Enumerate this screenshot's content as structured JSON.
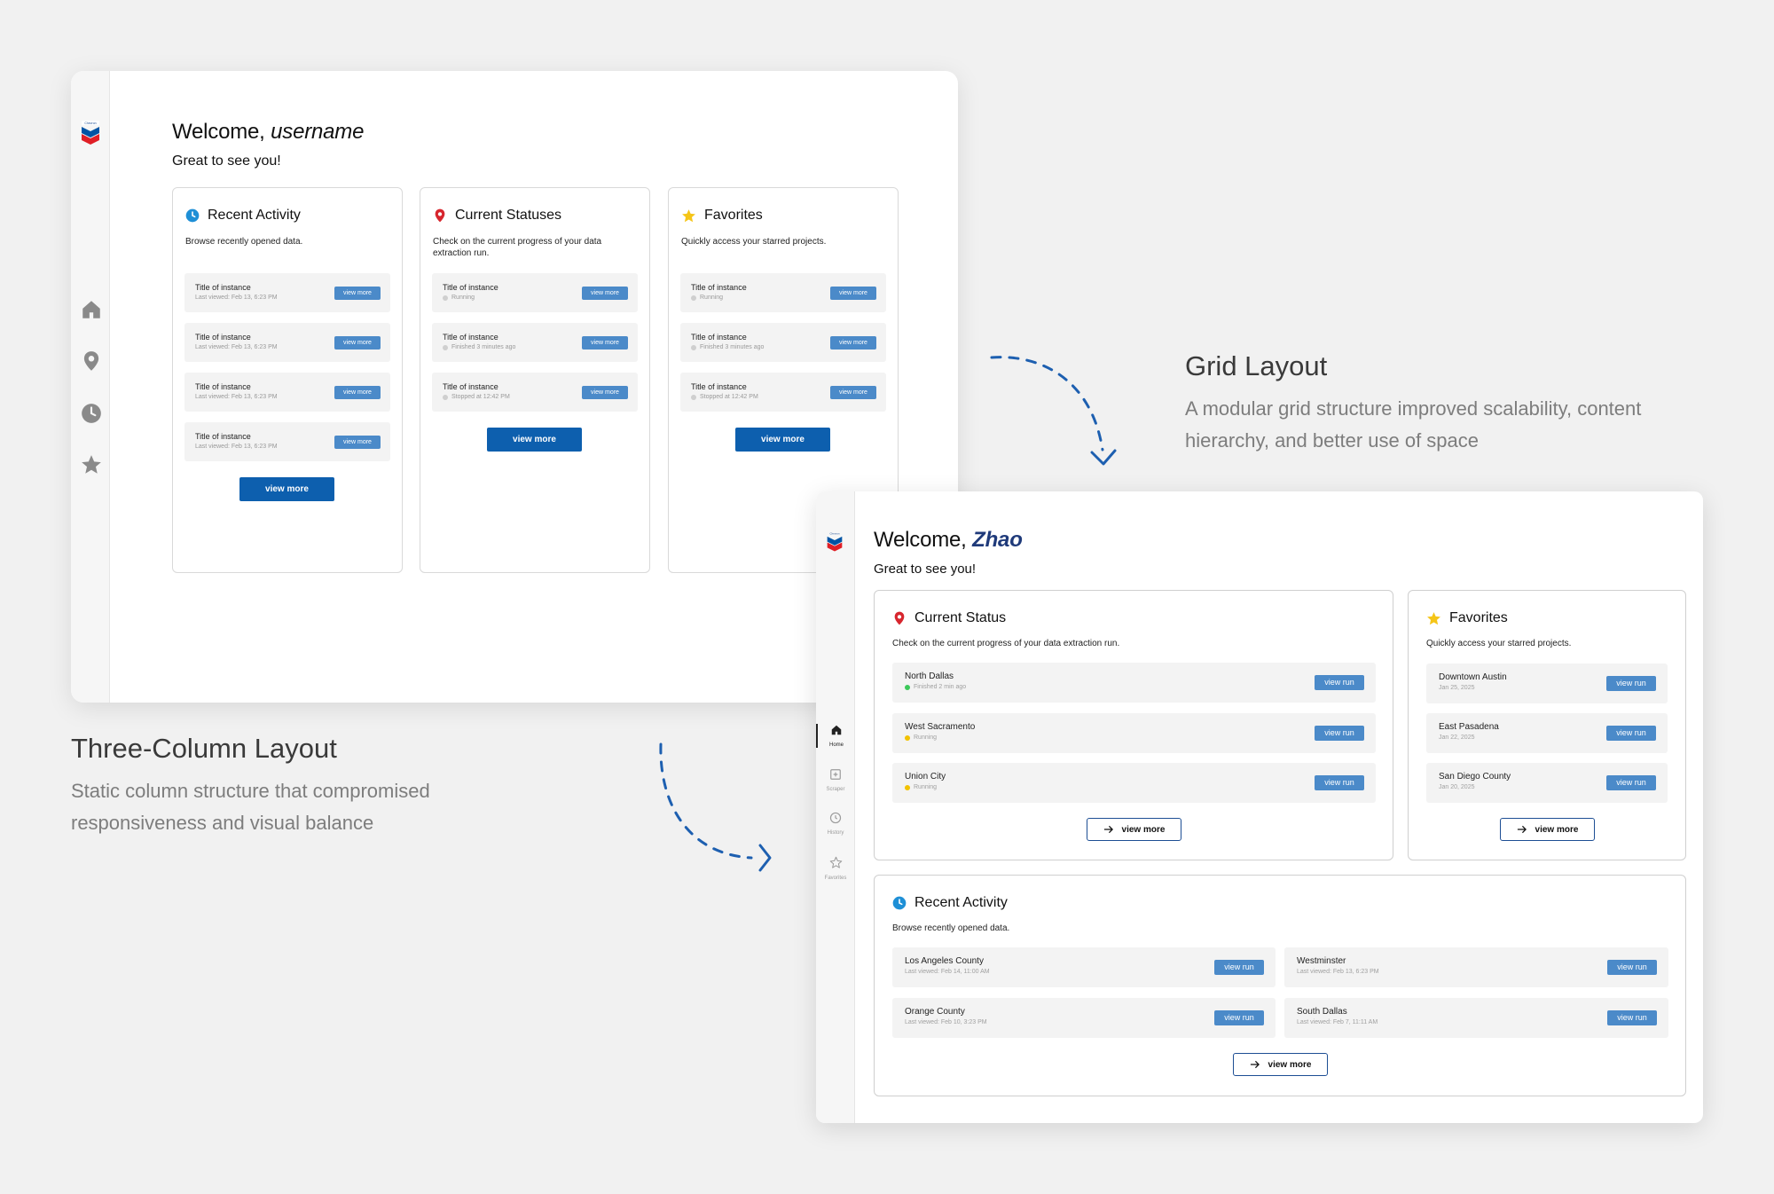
{
  "old": {
    "welcome_prefix": "Welcome, ",
    "welcome_name": "username",
    "subtitle": "Great to see you!",
    "cards": [
      {
        "title": "Recent Activity",
        "icon": "clock-icon",
        "icon_color": "#1e8fd6",
        "description": "Browse recently opened data.",
        "items": [
          {
            "title": "Title of instance",
            "sub": "Last viewed: Feb 13, 6:23 PM",
            "button": "view more"
          },
          {
            "title": "Title of instance",
            "sub": "Last viewed: Feb 13, 6:23 PM",
            "button": "view more"
          },
          {
            "title": "Title of instance",
            "sub": "Last viewed: Feb 13, 6:23 PM",
            "button": "view more"
          },
          {
            "title": "Title of instance",
            "sub": "Last viewed: Feb 13, 6:23 PM",
            "button": "view more"
          }
        ],
        "view_more": "view more"
      },
      {
        "title": "Current Statuses",
        "icon": "map-pin-icon",
        "icon_color": "#d7262e",
        "description": "Check on the current progress of your data extraction run.",
        "items": [
          {
            "title": "Title of instance",
            "sub": "Running",
            "button": "view more"
          },
          {
            "title": "Title of instance",
            "sub": "Finished 3 minutes ago",
            "button": "view more"
          },
          {
            "title": "Title of instance",
            "sub": "Stopped at 12:42 PM",
            "button": "view more"
          }
        ],
        "view_more": "view more"
      },
      {
        "title": "Favorites",
        "icon": "star-icon",
        "icon_color": "#f5c518",
        "description": "Quickly access your starred projects.",
        "items": [
          {
            "title": "Title of instance",
            "sub": "Running",
            "button": "view more"
          },
          {
            "title": "Title of instance",
            "sub": "Finished 3 minutes ago",
            "button": "view more"
          },
          {
            "title": "Title of instance",
            "sub": "Stopped at 12:42 PM",
            "button": "view more"
          }
        ],
        "view_more": "view more"
      }
    ],
    "nav_icons": [
      "home-icon",
      "map-pin-icon",
      "clock-icon",
      "star-icon"
    ]
  },
  "annotations": {
    "grid_title": "Grid Layout",
    "grid_desc_1": "A modular grid structure improved scalability, content",
    "grid_desc_2": "hierarchy, and better use of space",
    "three_title": "Three-Column Layout",
    "three_desc_1": "Static column structure that compromised",
    "three_desc_2": "responsiveness and visual balance"
  },
  "new": {
    "welcome_prefix": "Welcome, ",
    "welcome_name": "Zhao",
    "subtitle": "Great to see you!",
    "nav": [
      {
        "label": "Home",
        "icon": "home-icon",
        "active": true
      },
      {
        "label": "Scraper",
        "icon": "plus-box-icon",
        "active": false
      },
      {
        "label": "History",
        "icon": "clock-icon",
        "active": false
      },
      {
        "label": "Favorites",
        "icon": "star-icon",
        "active": false
      }
    ],
    "current_status": {
      "title": "Current Status",
      "description": "Check on the current progress of your data extraction run.",
      "items": [
        {
          "title": "North Dallas",
          "sub": "Finished 2 min ago",
          "dot": "#3cc85a",
          "button": "view run"
        },
        {
          "title": "West Sacramento",
          "sub": "Running",
          "dot": "#f2c200",
          "button": "view run"
        },
        {
          "title": "Union City",
          "sub": "Running",
          "dot": "#f2c200",
          "button": "view run"
        }
      ],
      "view_more": "view more"
    },
    "favorites": {
      "title": "Favorites",
      "description": "Quickly access your starred projects.",
      "items": [
        {
          "title": "Downtown Austin",
          "sub": "Jan 25, 2025",
          "button": "view run"
        },
        {
          "title": "East Pasadena",
          "sub": "Jan 22, 2025",
          "button": "view run"
        },
        {
          "title": "San Diego County",
          "sub": "Jan 20, 2025",
          "button": "view run"
        }
      ],
      "view_more": "view more"
    },
    "recent_activity": {
      "title": "Recent Activity",
      "description": "Browse recently opened data.",
      "items": [
        {
          "title": "Los Angeles County",
          "sub": "Last viewed: Feb 14, 11:00 AM",
          "button": "view run"
        },
        {
          "title": "Westminster",
          "sub": "Last viewed: Feb 13, 6:23 PM",
          "button": "view run"
        },
        {
          "title": "Orange County",
          "sub": "Last viewed: Feb 10, 3:23 PM",
          "button": "view run"
        },
        {
          "title": "South Dallas",
          "sub": "Last viewed: Feb 7, 11:11 AM",
          "button": "view run"
        }
      ],
      "view_more": "view more"
    }
  },
  "colors": {
    "accent_blue": "#0d5fae",
    "button_blue": "#4b8ac9",
    "arrow_blue": "#1d5fb0"
  }
}
